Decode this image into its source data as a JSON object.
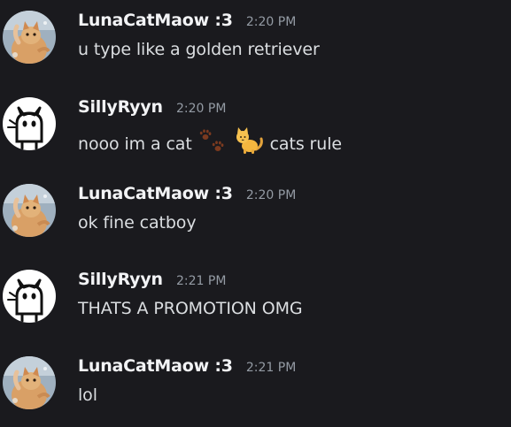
{
  "messages": [
    {
      "author": "LunaCatMaow :3",
      "time": "2:20 PM",
      "text": "u type like a golden retriever",
      "avatar": "orange-cat-avatar"
    },
    {
      "author": "SillyRyyn",
      "time": "2:20 PM",
      "text_before": "nooo im a cat",
      "emojis": [
        "paw-prints-emoji",
        "cat-emoji"
      ],
      "text_after": "cats rule",
      "avatar": "drawn-cat-avatar"
    },
    {
      "author": "LunaCatMaow :3",
      "time": "2:20 PM",
      "text": "ok fine catboy",
      "avatar": "orange-cat-avatar"
    },
    {
      "author": "SillyRyyn",
      "time": "2:21 PM",
      "text": "THATS A PROMOTION OMG",
      "avatar": "drawn-cat-avatar"
    },
    {
      "author": "LunaCatMaow :3",
      "time": "2:21 PM",
      "text": "lol",
      "avatar": "orange-cat-avatar"
    }
  ],
  "colors": {
    "background": "#1a1a1e",
    "author": "#f2f3f5",
    "timestamp": "#949ba4",
    "text": "#dbdee1"
  }
}
